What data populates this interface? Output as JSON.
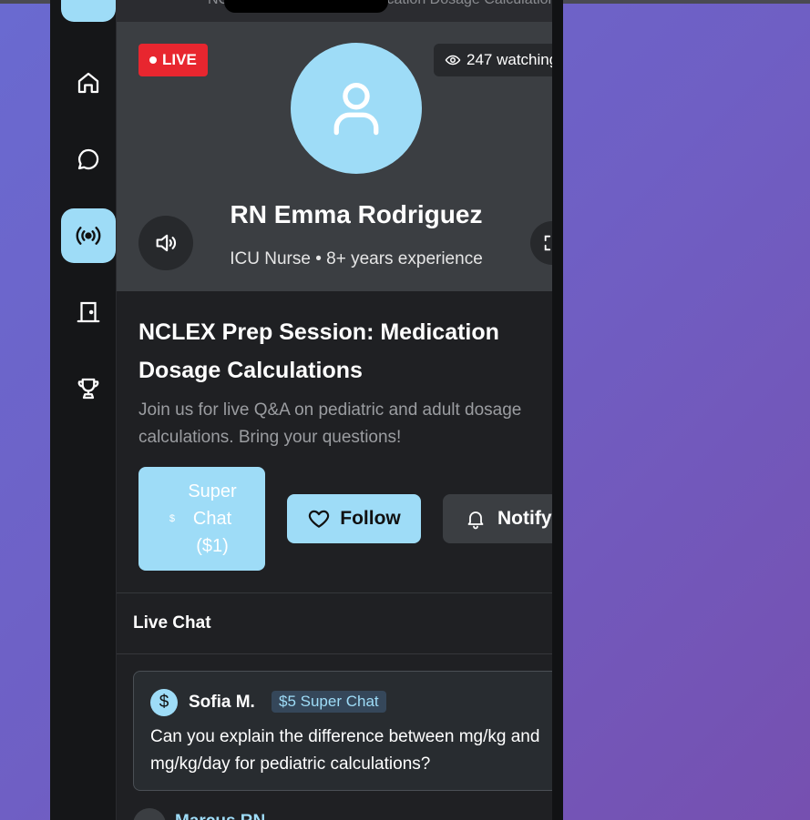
{
  "topbar": {
    "clipped_text": "NCLEX Prep Session: Medication Dosage Calculations"
  },
  "rail": {
    "items": [
      {
        "icon": "home-icon"
      },
      {
        "icon": "chat-bubble-icon"
      },
      {
        "icon": "broadcast-icon",
        "active": true
      },
      {
        "icon": "door-icon"
      },
      {
        "icon": "trophy-icon"
      }
    ]
  },
  "stream": {
    "live_label": "LIVE",
    "viewers_label": "247 watching",
    "host_name": "RN Emma Rodriguez",
    "host_meta": "ICU Nurse • 8+ years experience",
    "title": "NCLEX Prep Session: Medication Dosage Calculations",
    "description": "Join us for live Q&A on pediatric and adult dosage calculations. Bring your questions!"
  },
  "actions": {
    "superchat_icon": "$",
    "superchat_label": "Super Chat ($1)",
    "follow_label": "Follow",
    "notify_label": "Notify"
  },
  "chat": {
    "title": "Live Chat",
    "messages": [
      {
        "user": "Sofia M.",
        "badge": "$5 Super Chat",
        "avatar_icon": "$",
        "text": "Can you explain the difference between mg/kg and mg/kg/day for pediatric calculations?"
      }
    ],
    "next_user_partial": "Marcus RN"
  },
  "colors": {
    "accent": "#9edcf7",
    "live": "#e8262f",
    "panel": "#1f2023",
    "hero": "#3b3e42"
  }
}
